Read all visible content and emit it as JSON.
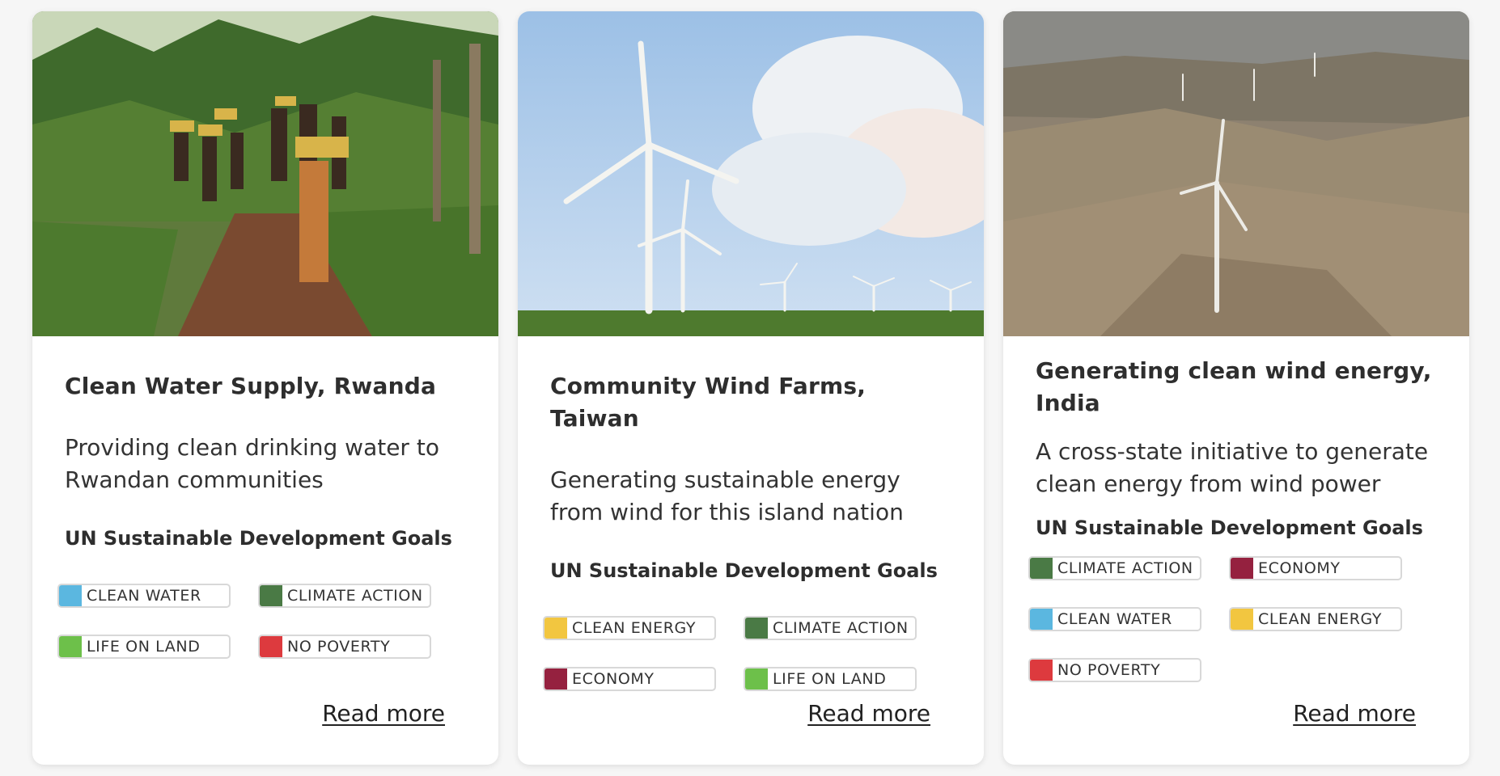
{
  "cards": [
    {
      "title": "Clean Water Supply, Rwanda",
      "description": "Providing clean drinking water to Rwandan communities",
      "goals_heading": "UN Sustainable Development Goals",
      "tags": [
        {
          "label": "CLEAN WATER",
          "color": "#5bb7e0"
        },
        {
          "label": "CLIMATE ACTION",
          "color": "#4a7a45"
        },
        {
          "label": "LIFE ON LAND",
          "color": "#6dc04a"
        },
        {
          "label": "NO POVERTY",
          "color": "#dd3a3e"
        }
      ],
      "read_more": "Read more"
    },
    {
      "title": "Community Wind Farms, Taiwan",
      "description": "Generating sustainable energy from wind for this island nation",
      "goals_heading": "UN Sustainable Development Goals",
      "tags": [
        {
          "label": "CLEAN ENERGY",
          "color": "#f2c640"
        },
        {
          "label": "CLIMATE ACTION",
          "color": "#4a7a45"
        },
        {
          "label": "ECONOMY",
          "color": "#95213f"
        },
        {
          "label": "LIFE ON LAND",
          "color": "#6dc04a"
        }
      ],
      "read_more": "Read more"
    },
    {
      "title": "Generating clean wind energy, India",
      "description": "A cross-state initiative to generate clean energy from wind power",
      "goals_heading": "UN Sustainable Development Goals",
      "tags": [
        {
          "label": "CLIMATE ACTION",
          "color": "#4a7a45"
        },
        {
          "label": "ECONOMY",
          "color": "#95213f"
        },
        {
          "label": "CLEAN WATER",
          "color": "#5bb7e0"
        },
        {
          "label": "CLEAN ENERGY",
          "color": "#f2c640"
        },
        {
          "label": "NO POVERTY",
          "color": "#dd3a3e"
        }
      ],
      "read_more": "Read more"
    }
  ]
}
